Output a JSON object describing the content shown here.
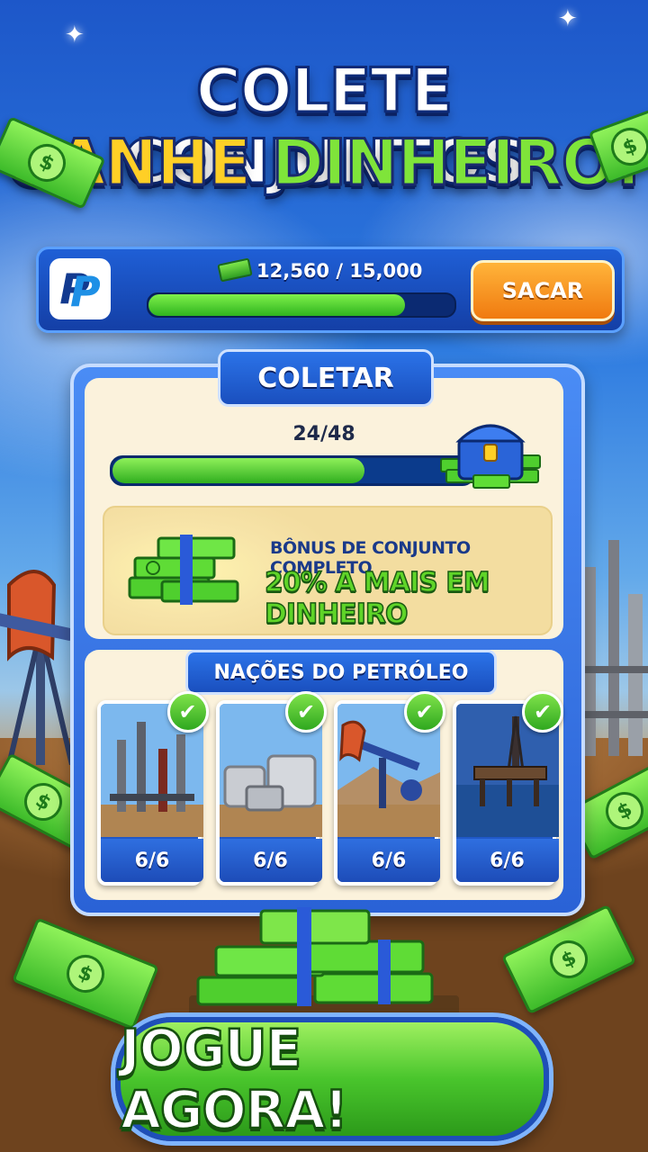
{
  "headline": {
    "line1": "COLETE CONJUNTOS",
    "line2_part1": "GANHE",
    "line2_part2": "DINHEIRO!"
  },
  "payout": {
    "logo": "P",
    "progress_text": "12,560 / 15,000",
    "progress_value": 12560,
    "progress_max": 15000,
    "withdraw_label": "SACAR"
  },
  "collect": {
    "title": "COLETAR",
    "count_text": "24/48",
    "count_value": 24,
    "count_max": 48,
    "bonus_title": "BÔNUS DE CONJUNTO COMPLETO",
    "bonus_value": "20% A MAIS EM DINHEIRO"
  },
  "set": {
    "title": "NAÇÕES DO PETRÓLEO",
    "cards": [
      {
        "name": "refinery",
        "progress": "6/6",
        "complete": true
      },
      {
        "name": "storage-tanks",
        "progress": "6/6",
        "complete": true
      },
      {
        "name": "pumpjack",
        "progress": "6/6",
        "complete": true
      },
      {
        "name": "offshore-platform",
        "progress": "6/6",
        "complete": true
      }
    ]
  },
  "cta": {
    "label": "JOGUE AGORA!"
  },
  "colors": {
    "brand_blue": "#1f5fd6",
    "accent_green": "#49c52c",
    "accent_orange": "#f07a10",
    "gold": "#ffcf26"
  },
  "icons": [
    "paypal-icon",
    "cash-icon",
    "chest-icon",
    "cash-stack-icon",
    "check-icon",
    "dollar-bill-icon"
  ]
}
